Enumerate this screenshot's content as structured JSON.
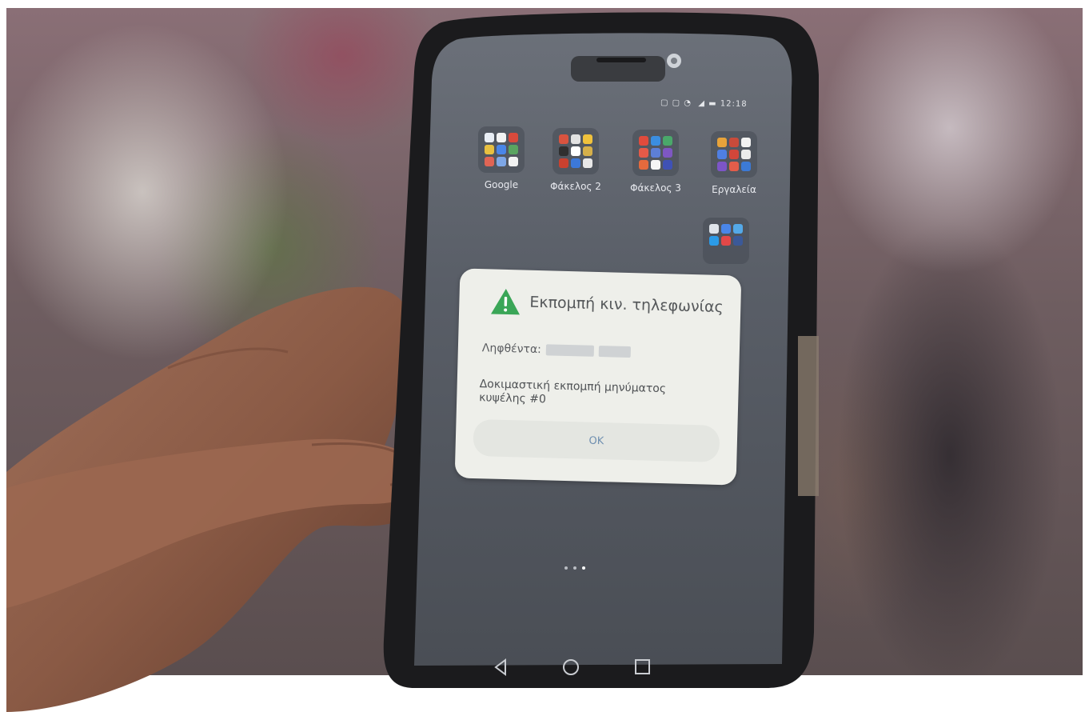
{
  "status_bar": {
    "time": "12:18"
  },
  "home_screen": {
    "folders": [
      {
        "label": "Google"
      },
      {
        "label": "Φάκελος 2"
      },
      {
        "label": "Φάκελος 3"
      },
      {
        "label": "Εργαλεία"
      }
    ]
  },
  "dialog": {
    "icon": "warning-triangle-icon",
    "icon_color": "#3aa657",
    "title": "Εκπομπή κιν. τηλεφωνίας",
    "received_label": "Ληφθέντα:",
    "message": "Δοκιμαστική εκπομπή μηνύματος κυψέλης #0",
    "ok_label": "OK",
    "ok_color": "#6f8fb0"
  },
  "nav_bar": {
    "icons": [
      "back-icon",
      "home-icon",
      "recents-icon"
    ]
  }
}
